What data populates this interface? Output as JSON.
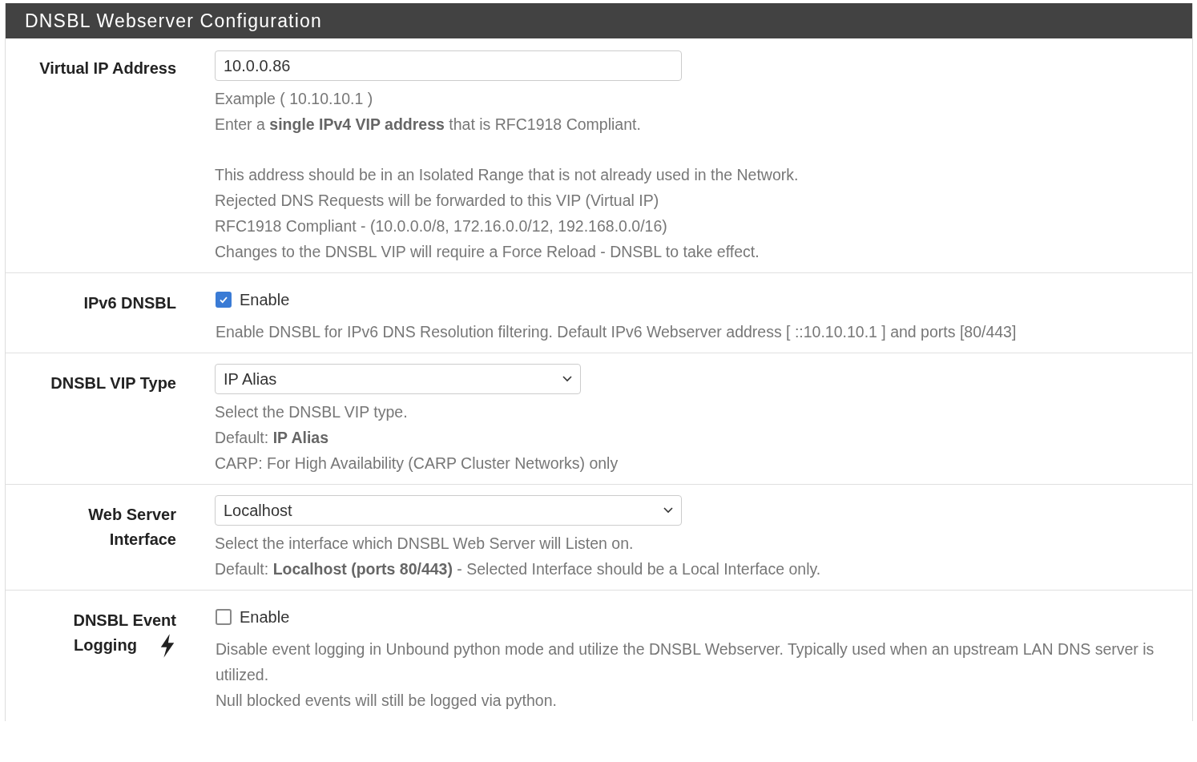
{
  "panel": {
    "title": "DNSBL Webserver Configuration"
  },
  "rows": [
    {
      "kind": "text",
      "label": [
        "Virtual IP Address"
      ],
      "value": "10.0.0.86",
      "help": [
        [
          "Example ( 10.10.10.1 )",
          "Enter a **single IPv4 VIP address** that is RFC1918 Compliant."
        ],
        [
          "This address should be in an Isolated Range that is not already used in the Network.",
          "Rejected DNS Requests will be forwarded to this VIP (Virtual IP)",
          "RFC1918 Compliant - (10.0.0.0/8, 172.16.0.0/12, 192.168.0.0/16)",
          "Changes to the DNSBL VIP will require a Force Reload - DNSBL to take effect."
        ]
      ]
    },
    {
      "kind": "checkbox",
      "label": [
        "IPv6 DNSBL"
      ],
      "option": "Enable",
      "checked": true,
      "help": [
        [
          "Enable DNSBL for IPv6 DNS Resolution filtering. Default IPv6 Webserver address [ ::10.10.10.1 ] and ports [80/443]"
        ]
      ]
    },
    {
      "kind": "select",
      "label": [
        "DNSBL VIP Type"
      ],
      "value": "IP Alias",
      "help": [
        [
          "Select the DNSBL VIP type.",
          "Default: **IP Alias**",
          "CARP: For High Availability (CARP Cluster Networks) only"
        ]
      ]
    },
    {
      "kind": "select",
      "label": [
        "Web Server",
        "Interface"
      ],
      "value": "Localhost",
      "help": [
        [
          "Select the interface which DNSBL Web Server will Listen on.",
          "Default: **Localhost (ports 80/443)** - Selected Interface should be a Local Interface only."
        ]
      ]
    },
    {
      "kind": "checkbox",
      "label": [
        "DNSBL Event",
        "Logging"
      ],
      "option": "Enable",
      "checked": false,
      "bolt_icon": true,
      "help": [
        [
          "Disable event logging in Unbound python mode and utilize the DNSBL Webserver. Typically used when an upstream LAN DNS server is utilized.",
          "Null blocked events will still be logged via python."
        ]
      ]
    }
  ]
}
